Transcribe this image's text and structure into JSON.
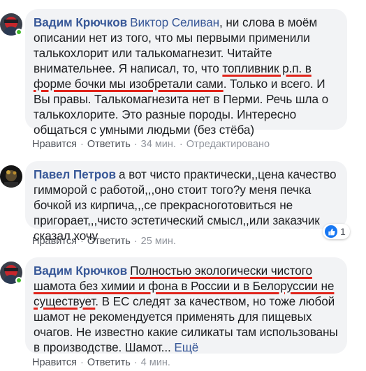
{
  "comments": [
    {
      "author": "Вадим Крючков",
      "mention": "Виктор Селиван",
      "text_before": ", ни слова в моём описании нет из того, что мы первыми применили талькохлорит или талькомагнезит. Читайте внимательнее. Я написал, то, что ",
      "text_underlined": "топливник р.п. в форме бочки мы изобретали сами",
      "text_after": ". Только и всего. И Вы правы. Талькомагнезита нет в Перми. Речь шла о талькохлорите. Это разные породы. Интересно общаться с умными людьми (без стёба)",
      "like_label": "Нравится",
      "reply_label": "Ответить",
      "time": "34 мин.",
      "edited": "Отредактировано"
    },
    {
      "author": "Павел Петров",
      "text": "а вот чисто практически,,цена качество гиммoрой с работой,,,оно стоит того?у меня печка бочкой из кирпича,,,се прекрасноготовиться не пригорает,,,чисто эстетический смысл,,или заказчик сказал хочу",
      "reaction_count": "1",
      "reaction_icon": "like-icon",
      "like_label": "Нравится",
      "reply_label": "Ответить",
      "time": "25 мин."
    },
    {
      "author": "Вадим Крючков",
      "text_underlined": "Полностью экологически чистого шамота без химии и фона в России и в Белоруссии не существует",
      "text_after": ". В ЕС следят за качеством, но тоже любой шамот не рекомендуется применять для пищевых очагов. Не известно какие силикаты там использованы в производстве. Шамот...",
      "more_label": "Ещё",
      "like_label": "Нравится",
      "reply_label": "Ответить",
      "time": "4 мин."
    }
  ],
  "colors": {
    "bubble_bg": "#f2f3f5",
    "link": "#385898",
    "underline": "#e0241b",
    "online": "#42b72a",
    "like_blue": "#1877f2"
  }
}
